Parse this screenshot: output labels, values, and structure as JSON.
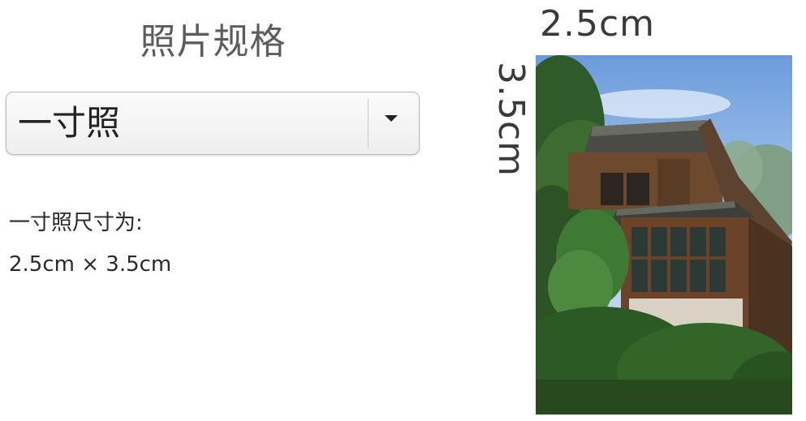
{
  "title": "照片规格",
  "size_select": {
    "selected": "一寸照"
  },
  "description": {
    "label": "一寸照尺寸为:",
    "value": "2.5cm × 3.5cm"
  },
  "preview": {
    "width_label": "2.5cm",
    "height_label": "3.5cm",
    "photo_subject": "traditional house with tiled roofs surrounded by trees"
  },
  "icons": {
    "dropdown": "caret-down-icon"
  },
  "colors": {
    "text_primary": "#222222",
    "title_gray": "#5c5c5c",
    "select_border": "#b9b9b9"
  }
}
